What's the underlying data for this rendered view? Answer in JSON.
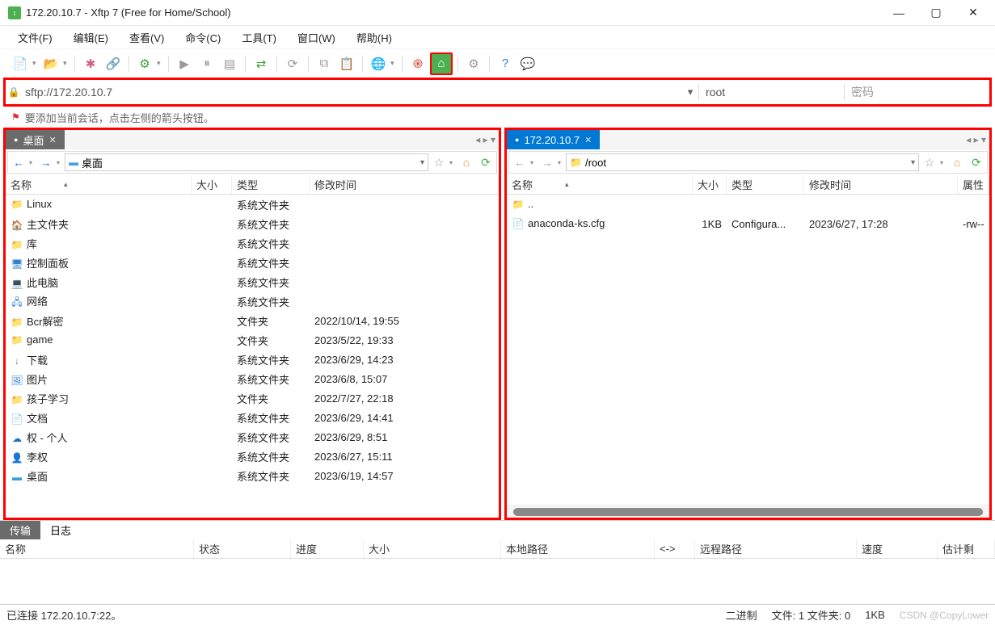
{
  "window": {
    "title": "172.20.10.7 - Xftp 7 (Free for Home/School)"
  },
  "menu": {
    "file": "文件(F)",
    "edit": "编辑(E)",
    "view": "查看(V)",
    "command": "命令(C)",
    "tool": "工具(T)",
    "window": "窗口(W)",
    "help": "帮助(H)"
  },
  "address": {
    "url": "sftp://172.20.10.7",
    "user": "root",
    "pass_placeholder": "密码"
  },
  "hint": "要添加当前会话，点击左侧的箭头按钮。",
  "left_pane": {
    "tab": "桌面",
    "path": "桌面",
    "cols": {
      "name": "名称",
      "size": "大小",
      "type": "类型",
      "mtime": "修改时间"
    },
    "rows": [
      {
        "icon": "folder",
        "name": "Linux",
        "type": "系统文件夹",
        "mtime": ""
      },
      {
        "icon": "home",
        "name": "主文件夹",
        "type": "系统文件夹",
        "mtime": ""
      },
      {
        "icon": "folder",
        "name": "库",
        "type": "系统文件夹",
        "mtime": ""
      },
      {
        "icon": "ctrl",
        "name": "控制面板",
        "type": "系统文件夹",
        "mtime": ""
      },
      {
        "icon": "pc",
        "name": "此电脑",
        "type": "系统文件夹",
        "mtime": ""
      },
      {
        "icon": "net",
        "name": "网络",
        "type": "系统文件夹",
        "mtime": ""
      },
      {
        "icon": "folder",
        "name": "Bcr解密",
        "type": "文件夹",
        "mtime": "2022/10/14, 19:55"
      },
      {
        "icon": "folder",
        "name": "game",
        "type": "文件夹",
        "mtime": "2023/5/22, 19:33"
      },
      {
        "icon": "dl",
        "name": "下载",
        "type": "系统文件夹",
        "mtime": "2023/6/29, 14:23"
      },
      {
        "icon": "img",
        "name": "图片",
        "type": "系统文件夹",
        "mtime": "2023/6/8, 15:07"
      },
      {
        "icon": "folder",
        "name": "孩子学习",
        "type": "文件夹",
        "mtime": "2022/7/27, 22:18"
      },
      {
        "icon": "doc",
        "name": "文档",
        "type": "系统文件夹",
        "mtime": "2023/6/29, 14:41"
      },
      {
        "icon": "cloud",
        "name": "权 - 个人",
        "type": "系统文件夹",
        "mtime": "2023/6/29, 8:51"
      },
      {
        "icon": "user",
        "name": "李权",
        "type": "系统文件夹",
        "mtime": "2023/6/27, 15:11"
      },
      {
        "icon": "desktop",
        "name": "桌面",
        "type": "系统文件夹",
        "mtime": "2023/6/19, 14:57"
      }
    ]
  },
  "right_pane": {
    "tab": "172.20.10.7",
    "path": "/root",
    "cols": {
      "name": "名称",
      "size": "大小",
      "type": "类型",
      "mtime": "修改时间",
      "attr": "属性"
    },
    "rows": [
      {
        "icon": "up",
        "name": "..",
        "size": "",
        "type": "",
        "mtime": "",
        "attr": ""
      },
      {
        "icon": "file",
        "name": "anaconda-ks.cfg",
        "size": "1KB",
        "type": "Configura...",
        "mtime": "2023/6/27, 17:28",
        "attr": "-rw--"
      }
    ]
  },
  "bottom": {
    "transfer": "传输",
    "log": "日志",
    "cols": {
      "name": "名称",
      "status": "状态",
      "progress": "进度",
      "size": "大小",
      "local": "本地路径",
      "arrows": "<->",
      "remote": "远程路径",
      "speed": "速度",
      "eta": "估计剩"
    }
  },
  "status": {
    "msg": "已连接 172.20.10.7:22。",
    "binary": "二进制",
    "files": "文件: 1 文件夹: 0",
    "size": "1KB",
    "watermark": "CSDN @CopyLower"
  }
}
